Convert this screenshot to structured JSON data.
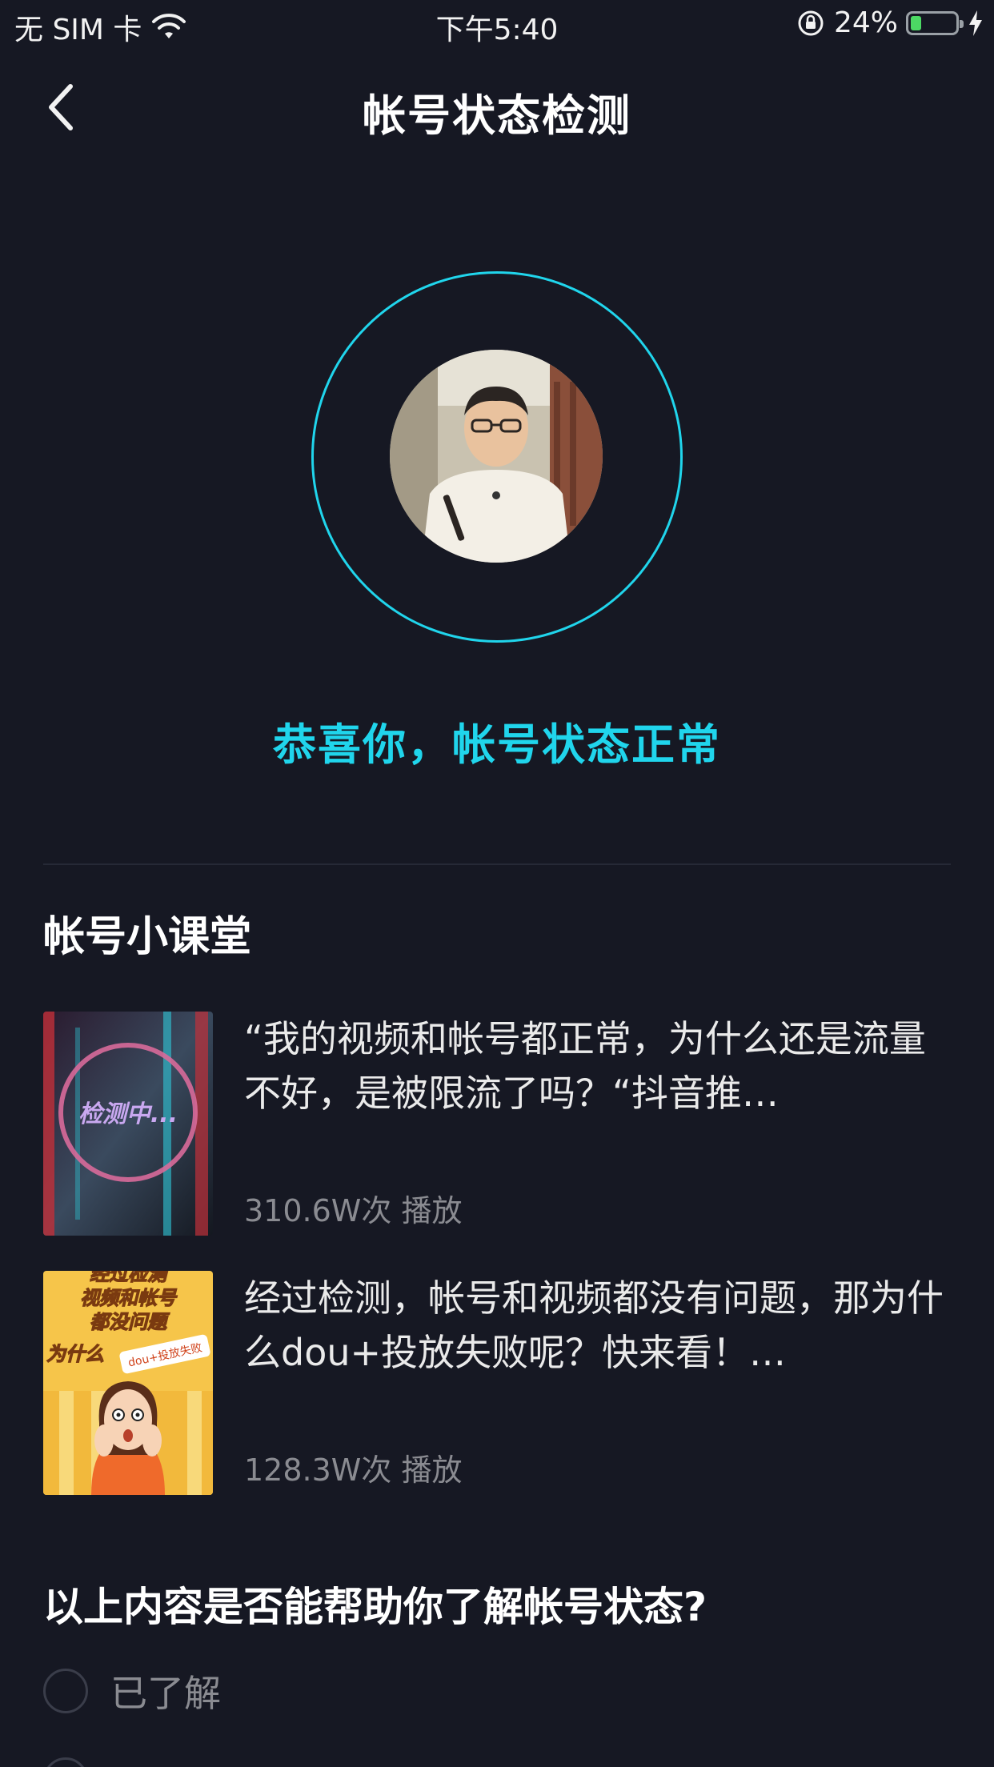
{
  "status_bar": {
    "carrier": "无 SIM 卡",
    "time": "下午5:40",
    "battery": "24%",
    "battery_level": 0.24
  },
  "nav": {
    "title": "帐号状态检测"
  },
  "detection": {
    "result": "恭喜你，帐号状态正常",
    "ring_color": "#20d5ec"
  },
  "lessons": {
    "title": "帐号小课堂",
    "items": [
      {
        "title": "“我的视频和帐号都正常，为什么还是流量不好，是被限流了吗？“抖音推…",
        "plays": "310.6W次",
        "plays_suffix": "播放",
        "thumb_text": "检测中..."
      },
      {
        "title": "经过检测，帐号和视频都没有问题，那为什么dou+投放失败呢？快来看！…",
        "plays": "128.3W次",
        "plays_suffix": "播放",
        "thumb_lines": [
          "经过检测",
          "视频和帐号",
          "都没问题",
          "为什么"
        ],
        "thumb_tag": "dou+投放失败"
      }
    ]
  },
  "feedback": {
    "question": "以上内容是否能帮助你了解帐号状态?",
    "options": [
      "已了解"
    ]
  },
  "colors": {
    "background": "#161823",
    "accent": "#20d5ec",
    "muted_text": "#8a8b91"
  }
}
